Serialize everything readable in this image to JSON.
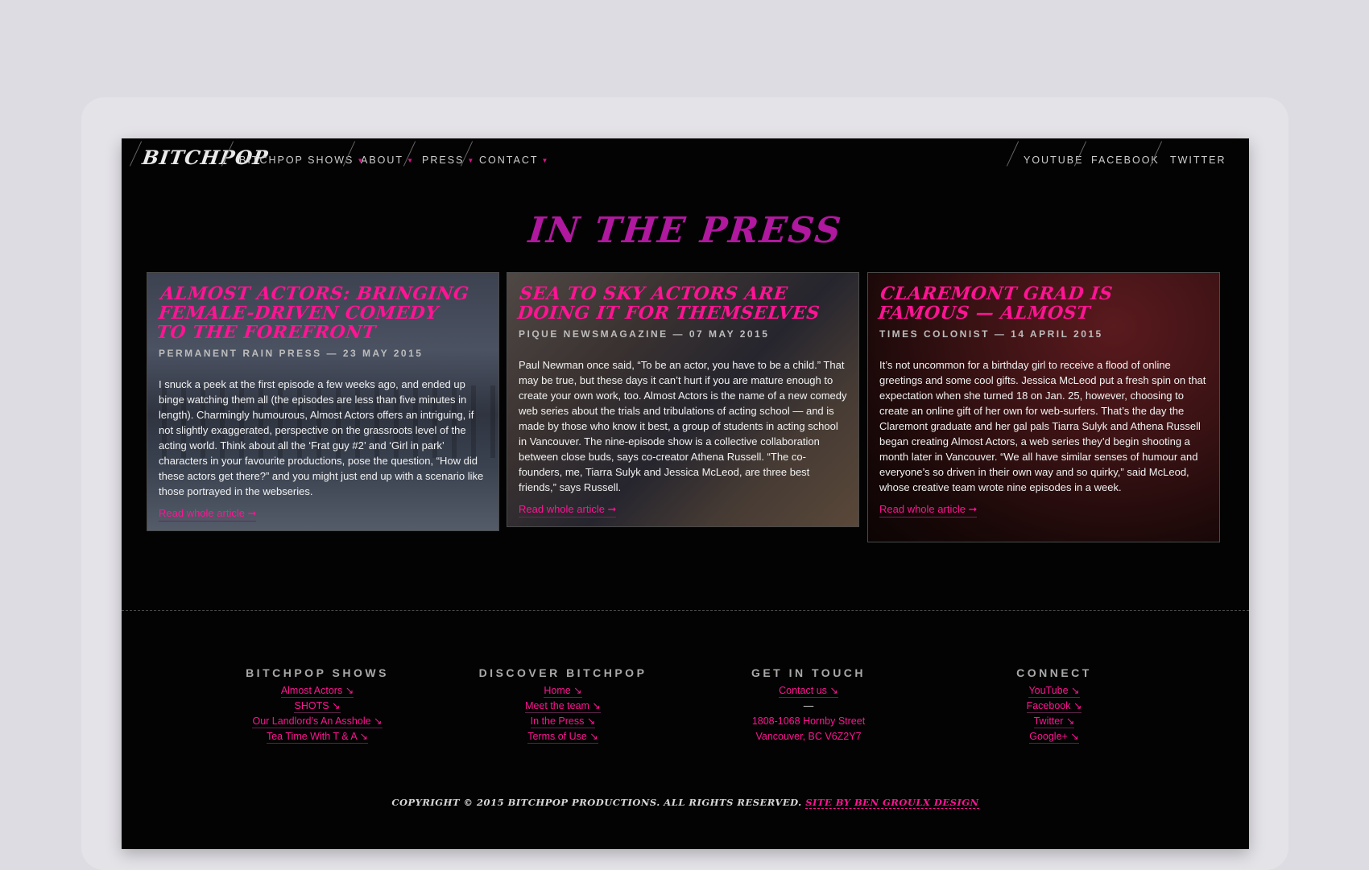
{
  "nav": {
    "logo": "BITCHPOP",
    "items": [
      {
        "label": "BITCHPOP SHOWS"
      },
      {
        "label": "ABOUT"
      },
      {
        "label": "PRESS"
      },
      {
        "label": "CONTACT"
      }
    ],
    "social": [
      {
        "label": "YOUTUBE"
      },
      {
        "label": "FACEBOOK"
      },
      {
        "label": "TWITTER"
      }
    ]
  },
  "page_title": "IN THE PRESS",
  "articles": [
    {
      "title": "Almost Actors: Bringing Female-Driven Comedy to the Forefront",
      "source": "Permanent Rain Press — 23 May 2015",
      "text": "I snuck a peek at the first episode a few weeks ago, and ended up binge watching them all (the episodes are less than five minutes in length). Charmingly humourous, Almost Actors offers an intriguing, if not slightly exaggerated, perspective on the grassroots level of the acting world. Think about all the ‘Frat guy #2’ and ‘Girl in park’ characters in your favourite productions, pose the question, “How did these actors get there?” and you might just end up with a scenario like those portrayed in the webseries.",
      "link": "Read whole article ➞"
    },
    {
      "title": "Sea to Sky actors are doing it for themselves",
      "source": "Pique Newsmagazine — 07 May 2015",
      "text": "Paul Newman once said, “To be an actor, you have to be a child.” That may be true, but these days it can’t hurt if you are mature enough to create your own work, too. Almost Actors is the name of a new comedy web series about the trials and tribulations of acting school — and is made by those who know it best, a group of students in acting school in Vancouver. The nine-episode show is a collective collaboration between close buds, says co-creator Athena Russell. “The co-founders, me, Tiarra Sulyk and Jessica McLeod, are three best friends,” says Russell.",
      "link": "Read whole article ➞"
    },
    {
      "title": "Claremont grad is famous — almost",
      "source": "Times Colonist — 14 April 2015",
      "text": "It’s not uncommon for a birthday girl to receive a flood of online greetings and some cool gifts. Jessica McLeod put a fresh spin on that expectation when she turned 18 on Jan. 25, however, choosing to create an online gift of her own for web-surfers. That’s the day the Claremont graduate and her gal pals Tiarra Sulyk and Athena Russell began creating Almost Actors, a web series they’d begin shooting a month later in Vancouver. “We all have similar senses of humour and everyone’s so driven in their own way and so quirky,” said McLeod, whose creative team wrote nine episodes in a week.",
      "link": "Read whole article ➞"
    }
  ],
  "footer": {
    "shows": {
      "heading": "BITCHPOP SHOWS",
      "links": [
        "Almost Actors ↘",
        "SHOTS ↘",
        "Our Landlord’s An Asshole ↘",
        "Tea Time With T & A ↘"
      ]
    },
    "discover": {
      "heading": "DISCOVER BITCHPOP",
      "links": [
        "Home ↘",
        "Meet the team ↘",
        "In the Press ↘",
        "Terms of Use ↘"
      ]
    },
    "contact": {
      "heading": "GET IN TOUCH",
      "link": "Contact us ↘",
      "dash": "—",
      "address1": "1808-1068 Hornby Street",
      "address2": "Vancouver, BC V6Z2Y7"
    },
    "connect": {
      "heading": "CONNECT",
      "links": [
        "YouTube ↘",
        "Facebook ↘",
        "Twitter ↘",
        "Google+ ↘"
      ]
    },
    "copyright": "Copyright © 2015 BitchPop Productions. All rights reserved.",
    "credit": "Site by Ben Groulx Design"
  },
  "colors": {
    "accent": "#ff1493",
    "title": "#b0189f",
    "background": "#030303"
  }
}
